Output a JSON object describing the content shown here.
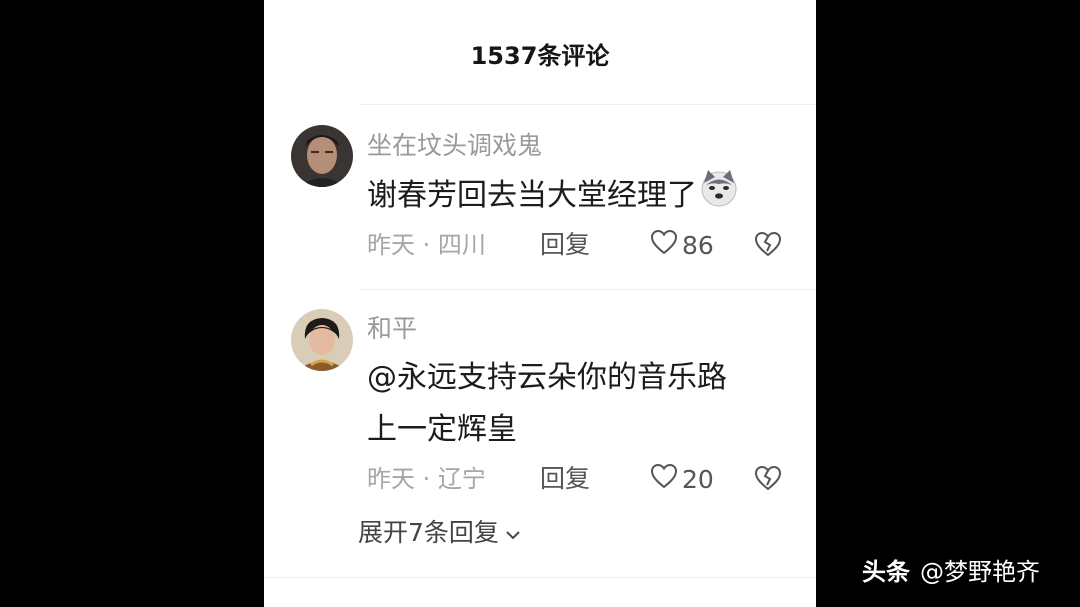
{
  "header": {
    "title": "1537条评论"
  },
  "comments": [
    {
      "username": "坐在坟头调戏鬼",
      "text": "谢春芳回去当大堂经理了",
      "emoji": "husky-dog-emoji",
      "time": "昨天",
      "separator": "·",
      "location": "四川",
      "reply_label": "回复",
      "likes": "86"
    },
    {
      "username": "和平",
      "text_line1": "@永远支持云朵你的音乐路",
      "text_line2": "上一定辉皇",
      "time": "昨天",
      "separator": "·",
      "location": "辽宁",
      "reply_label": "回复",
      "likes": "20",
      "expand_label": "展开7条回复"
    }
  ],
  "watermark": {
    "brand": "头条",
    "author": "@梦野艳齐"
  }
}
